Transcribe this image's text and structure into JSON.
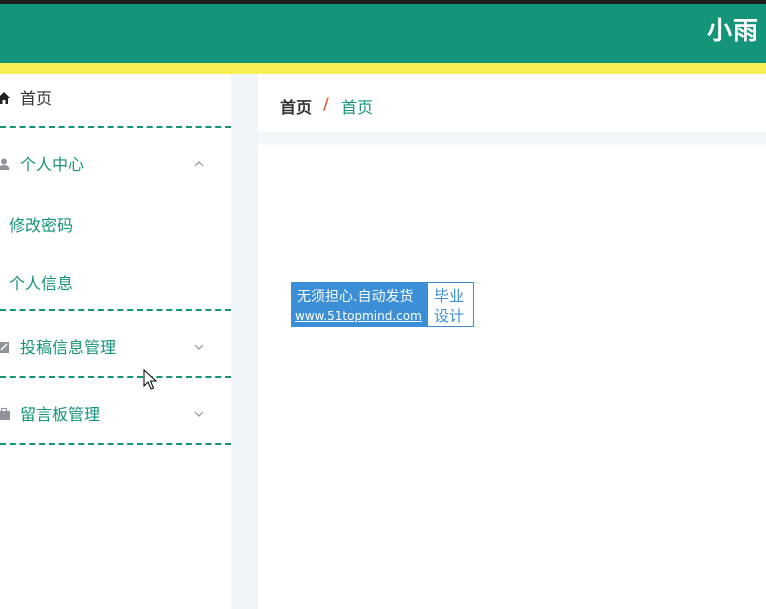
{
  "header": {
    "title": "小雨"
  },
  "sidebar": {
    "home": {
      "label": "首页",
      "icon": "home-icon"
    },
    "personal_center": {
      "label": "个人中心",
      "icon": "user-icon",
      "expanded": true,
      "children": [
        {
          "label": "修改密码"
        },
        {
          "label": "个人信息"
        }
      ]
    },
    "submission": {
      "label": "投稿信息管理",
      "icon": "edit-icon"
    },
    "message_board": {
      "label": "留言板管理",
      "icon": "briefcase-icon"
    }
  },
  "breadcrumb": {
    "first": "首页",
    "separator": "/",
    "current": "首页"
  },
  "watermark": {
    "line1": "无须担心.自动发货",
    "line2": "www.51topmind.com",
    "right1": "毕业",
    "right2": "设计"
  },
  "colors": {
    "primary": "#149479",
    "accent_bar": "#f7ef54",
    "separator": "#d9653b"
  }
}
